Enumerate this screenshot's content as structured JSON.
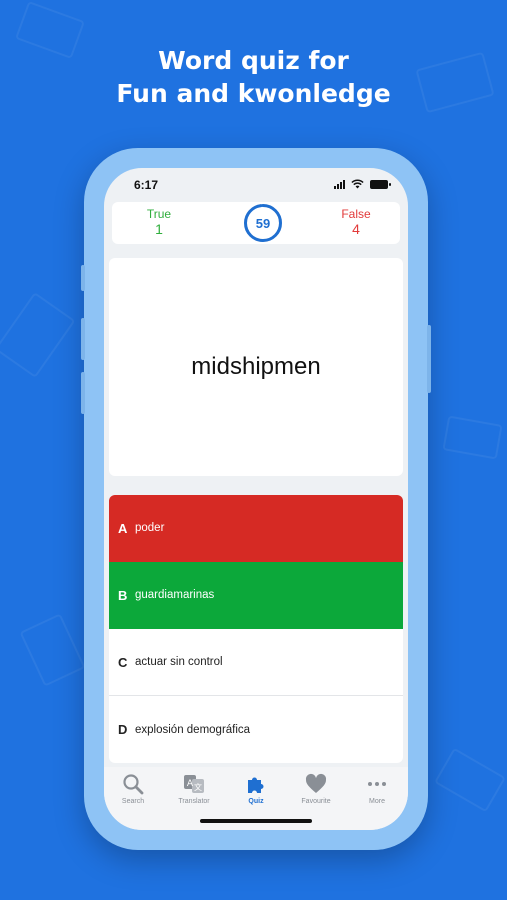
{
  "headline": {
    "line1": "Word quiz for",
    "line2": "Fun and kwonledge"
  },
  "status_bar": {
    "time": "6:17"
  },
  "score": {
    "true_label": "True",
    "true_count": "1",
    "false_label": "False",
    "false_count": "4",
    "timer_value": "59",
    "timer_progress": 0.98
  },
  "question": {
    "word": "midshipmen"
  },
  "options": [
    {
      "letter": "A",
      "text": "poder",
      "state": "wrong"
    },
    {
      "letter": "B",
      "text": "guardiamarinas",
      "state": "correct"
    },
    {
      "letter": "C",
      "text": "actuar sin control",
      "state": "neutral"
    },
    {
      "letter": "D",
      "text": "explosión demográfica",
      "state": "neutral"
    }
  ],
  "tabs": [
    {
      "label": "Search",
      "icon": "search-icon"
    },
    {
      "label": "Translator",
      "icon": "translator-icon"
    },
    {
      "label": "Quiz",
      "icon": "puzzle-icon",
      "active": true
    },
    {
      "label": "Favourite",
      "icon": "heart-icon"
    },
    {
      "label": "More",
      "icon": "more-icon"
    }
  ],
  "colors": {
    "background": "#1f72e0",
    "correct": "#0ca83a",
    "wrong": "#d62a24",
    "accent": "#1f6fd1"
  }
}
